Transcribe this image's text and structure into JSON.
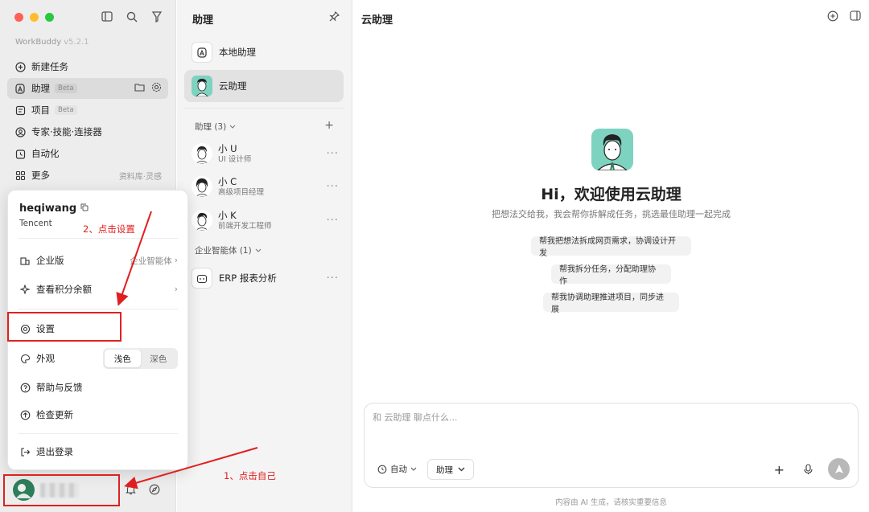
{
  "window": {
    "traffic_lights": [
      "close",
      "minimize",
      "zoom"
    ]
  },
  "sidebar": {
    "app_name": "WorkBuddy",
    "app_version": "v5.2.1",
    "nav": [
      {
        "label": "新建任务",
        "icon": "plus-circle-icon"
      },
      {
        "label": "助理",
        "badge": "Beta",
        "icon": "assistant-icon",
        "active": true
      },
      {
        "label": "项目",
        "badge": "Beta",
        "icon": "project-icon"
      },
      {
        "label": "专家·技能·连接器",
        "icon": "expert-icon"
      },
      {
        "label": "自动化",
        "icon": "clock-icon"
      },
      {
        "label": "更多",
        "icon": "grid-icon",
        "extra": "资料库·灵感"
      }
    ]
  },
  "popup": {
    "username": "heqiwang",
    "org": "Tencent",
    "items": {
      "enterprise": "企业版",
      "enterprise_side": "企业智能体",
      "credits": "查看积分余额",
      "settings": "设置",
      "appearance": "外观",
      "theme_light": "浅色",
      "theme_dark": "深色",
      "help": "帮助与反馈",
      "update": "检查更新",
      "logout": "退出登录"
    }
  },
  "annotations": {
    "step1": "1、点击自己",
    "step2": "2、点击设置"
  },
  "middle": {
    "title": "助理",
    "top_items": [
      {
        "label": "本地助理"
      },
      {
        "label": "云助理",
        "active": true
      }
    ],
    "group1": "助理 (3)",
    "agents": [
      {
        "name": "小 U",
        "role": "UI 设计师"
      },
      {
        "name": "小 C",
        "role": "高级项目经理"
      },
      {
        "name": "小 K",
        "role": "前端开发工程师"
      }
    ],
    "group2": "企业智能体 (1)",
    "enterprise_agent": "ERP 报表分析"
  },
  "main": {
    "title": "云助理",
    "hero_title": "Hi，欢迎使用云助理",
    "hero_sub": "把想法交给我，我会帮你拆解成任务，挑选最佳助理一起完成",
    "suggestions": [
      "帮我把想法拆成网页需求，协调设计开发",
      "帮我拆分任务，分配助理协作",
      "帮我协调助理推进项目，同步进展"
    ],
    "composer": {
      "placeholder": "和 云助理 聊点什么...",
      "mode": "自动",
      "assistant": "助理"
    },
    "footnote": "内容由 AI 生成，请核实重要信息"
  },
  "colors": {
    "annotation_red": "#e02020",
    "teal_avatar": "#7dd3c0"
  }
}
